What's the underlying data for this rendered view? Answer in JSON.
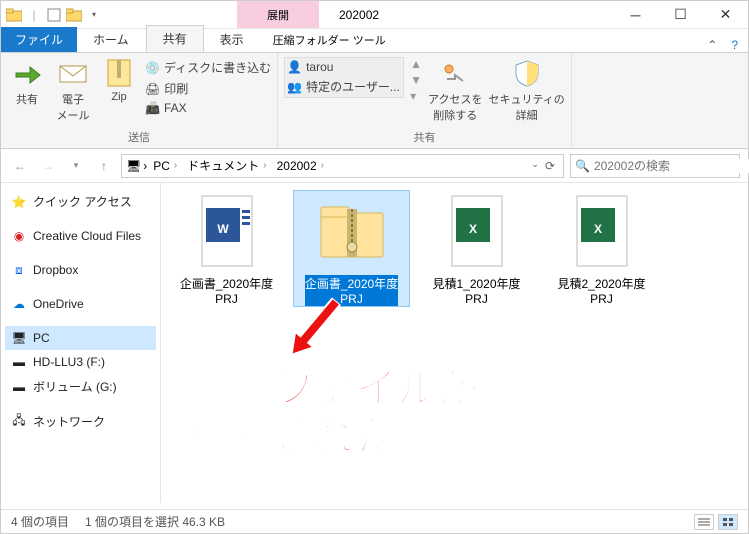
{
  "titlebar": {
    "context_label": "展開",
    "window_title": "202002"
  },
  "tabs": {
    "file": "ファイル",
    "home": "ホーム",
    "share": "共有",
    "view": "表示",
    "context": "圧縮フォルダー ツール"
  },
  "ribbon": {
    "send_group": "送信",
    "share_group": "共有",
    "share_btn": "共有",
    "mail_btn": "電子\nメール",
    "zip_btn": "Zip",
    "burn": "ディスクに書き込む",
    "print": "印刷",
    "fax": "FAX",
    "user1": "tarou",
    "user2": "特定のユーザー...",
    "remove_access": "アクセスを\n削除する",
    "security": "セキュリティの\n詳細"
  },
  "breadcrumb": {
    "pc": "PC",
    "docs": "ドキュメント",
    "folder": "202002"
  },
  "search": {
    "placeholder": "202002の検索"
  },
  "nav": {
    "quick": "クイック アクセス",
    "ccf": "Creative Cloud Files",
    "dropbox": "Dropbox",
    "onedrive": "OneDrive",
    "pc": "PC",
    "hdllu": "HD-LLU3 (F:)",
    "vol": "ボリューム (G:)",
    "network": "ネットワーク"
  },
  "files": [
    {
      "name": "企画書_2020年度\nPRJ",
      "type": "word"
    },
    {
      "name": "企画書_2020年度\nPRJ",
      "type": "zip",
      "selected": true
    },
    {
      "name": "見積1_2020年度\nPRJ",
      "type": "excel"
    },
    {
      "name": "見積2_2020年度\nPRJ",
      "type": "excel"
    }
  ],
  "status": {
    "count": "4 個の項目",
    "selected": "1 個の項目を選択 46.3 KB"
  },
  "annotation": "圧縮ファイルが\n保存された"
}
